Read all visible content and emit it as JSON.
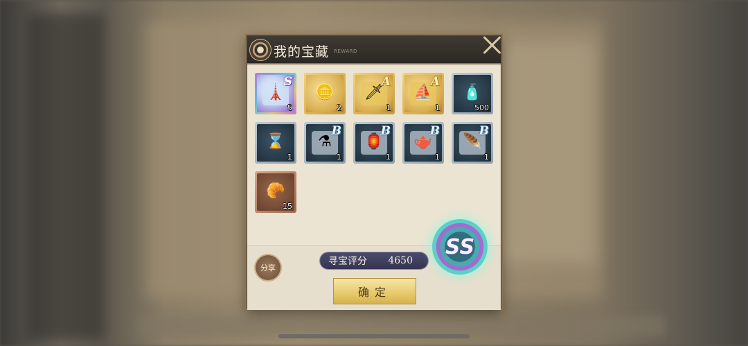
{
  "dialog": {
    "title": "我的宝藏",
    "subtitle": "REWARD",
    "close_icon": "close-icon"
  },
  "items": [
    {
      "id": "item-1",
      "frame": "s",
      "grade": "S",
      "count": "5",
      "icon": "tower-puzzle-icon"
    },
    {
      "id": "item-2",
      "frame": "gold",
      "grade": "",
      "count": "2",
      "icon": "coins-icon"
    },
    {
      "id": "item-3",
      "frame": "gold",
      "grade": "A",
      "count": "1",
      "icon": "dagger-puzzle-icon"
    },
    {
      "id": "item-4",
      "frame": "gold",
      "grade": "A",
      "count": "1",
      "icon": "ship-puzzle-icon"
    },
    {
      "id": "item-5",
      "frame": "blue",
      "grade": "",
      "count": "500",
      "icon": "bottle-icon"
    },
    {
      "id": "item-6",
      "frame": "blue",
      "grade": "",
      "count": "1",
      "icon": "hourglass-icon"
    },
    {
      "id": "item-7",
      "frame": "blue",
      "grade": "B",
      "count": "1",
      "icon": "potion-puzzle-icon"
    },
    {
      "id": "item-8",
      "frame": "blue",
      "grade": "B",
      "count": "1",
      "icon": "lantern-puzzle-icon"
    },
    {
      "id": "item-9",
      "frame": "blue",
      "grade": "B",
      "count": "1",
      "icon": "teapot-puzzle-icon"
    },
    {
      "id": "item-10",
      "frame": "blue",
      "grade": "B",
      "count": "1",
      "icon": "feather-puzzle-icon"
    },
    {
      "id": "item-11",
      "frame": "brown",
      "grade": "",
      "count": "15",
      "icon": "croissant-icon"
    }
  ],
  "footer": {
    "share_label": "分享",
    "score_label": "寻宝评分",
    "score_value": "4650",
    "confirm_label": "确定",
    "rank_badge": "SS"
  },
  "colors": {
    "accent_gold": "#e6c96a",
    "panel": "#ebe4d2",
    "titlebar": "#2c2823"
  }
}
